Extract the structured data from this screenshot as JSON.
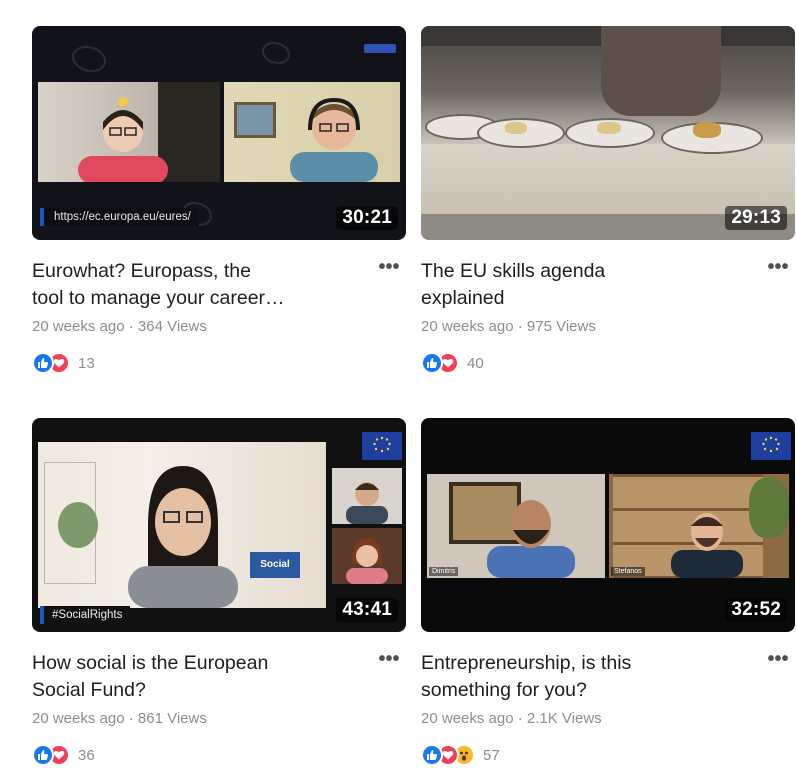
{
  "videos": [
    {
      "title_line1": "Eurowhat? Europass, the",
      "title_line2": "tool to manage your career…",
      "duration": "30:21",
      "meta": "20 weeks ago · 364 Views",
      "reactions_count": "13",
      "overlay_text": "https://ec.europa.eu/eures/"
    },
    {
      "title_line1": "The EU skills agenda",
      "title_line2": "explained",
      "duration": "29:13",
      "meta": "20 weeks ago · 975 Views",
      "reactions_count": "40"
    },
    {
      "title_line1": "How social is the European",
      "title_line2": "Social Fund?",
      "duration": "43:41",
      "meta": "20 weeks ago · 861 Views",
      "reactions_count": "36",
      "overlay_text": "#SocialRights",
      "overlay_brand": "Social"
    },
    {
      "title_line1": "Entrepreneurship, is this",
      "title_line2": "something for you?",
      "duration": "32:52",
      "meta": "20 weeks ago · 2.1K Views",
      "reactions_count": "57",
      "name_left": "Dimitris",
      "name_right": "Stefanos"
    }
  ],
  "more_label": "•••",
  "icons": {
    "like": "thumbs-up-icon",
    "love": "heart-icon",
    "wow": "wow-face-icon",
    "more": "more-options-icon"
  },
  "colors": {
    "like": "#1877f2",
    "love": "#f33e58",
    "wow": "#f7b928",
    "meta": "#8a8d91",
    "title": "#1c1e21"
  }
}
